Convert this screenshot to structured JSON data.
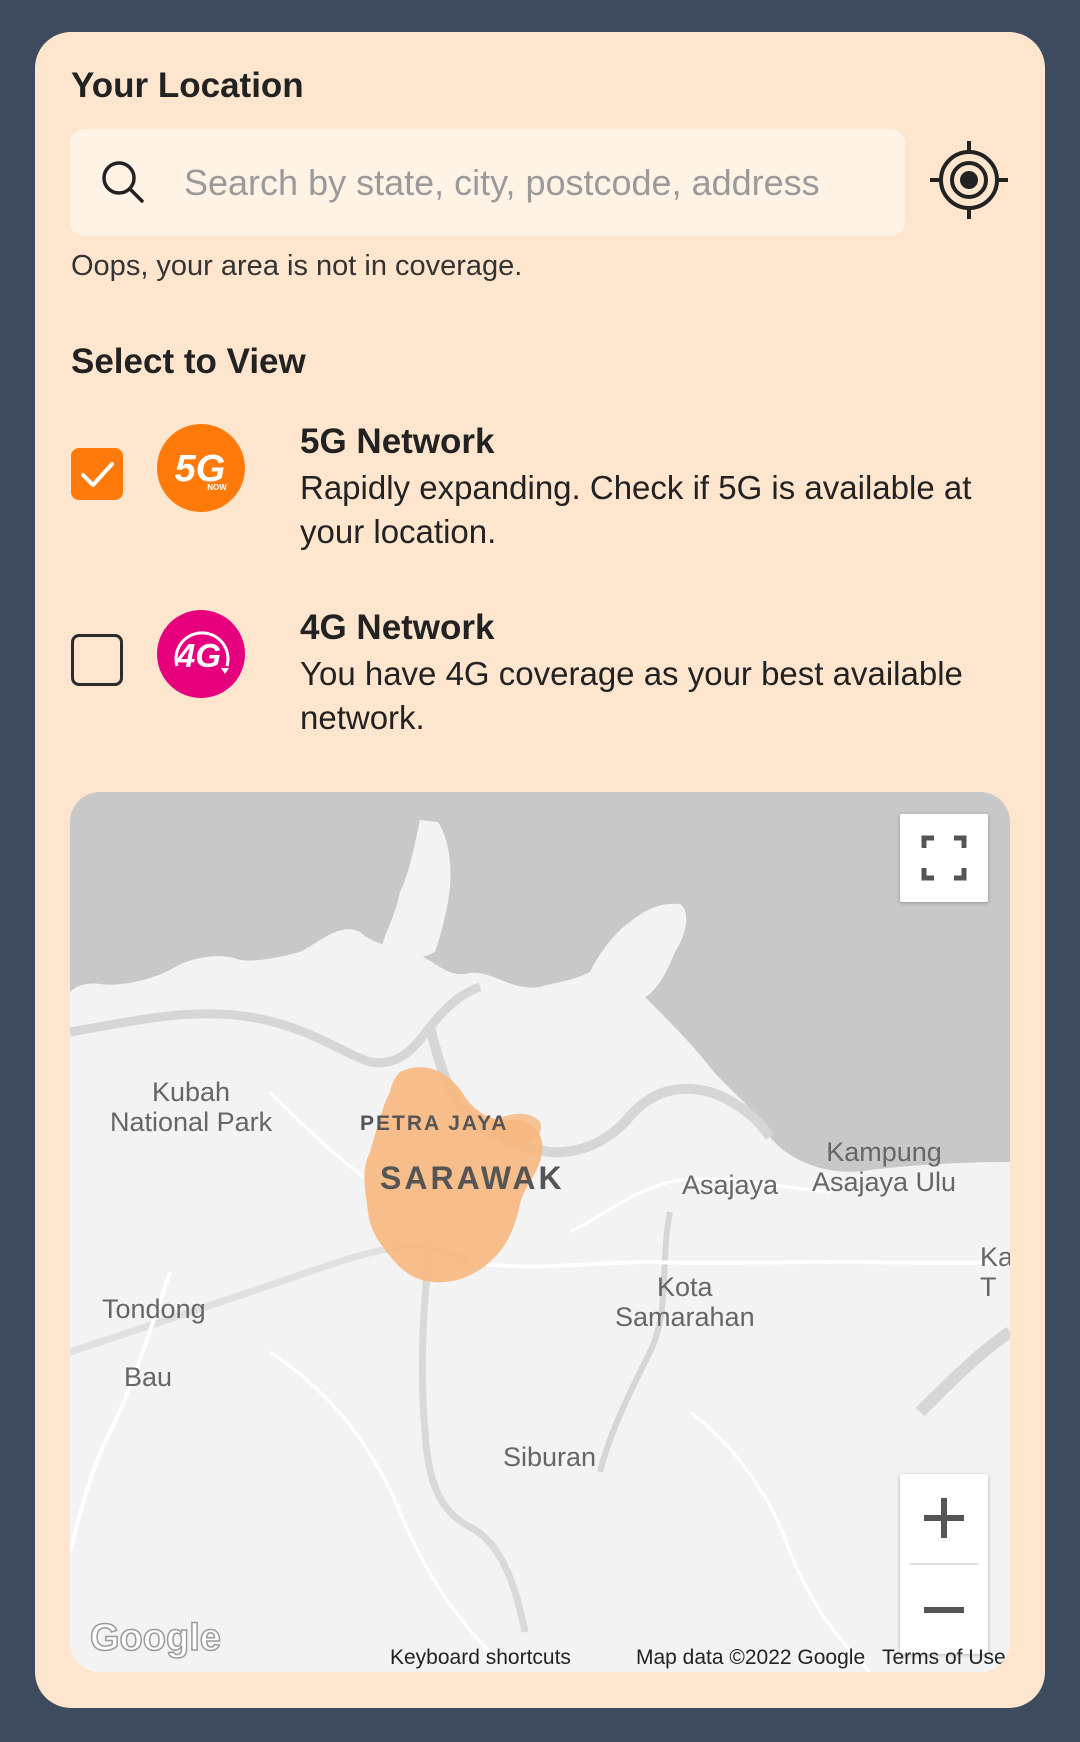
{
  "location": {
    "title": "Your Location",
    "search_placeholder": "Search by state, city, postcode, address",
    "search_value": "",
    "coverage_message": "Oops, your area is not in coverage."
  },
  "select": {
    "title": "Select to View",
    "networks": [
      {
        "name": "5G Network",
        "description": "Rapidly expanding. Check if 5G is available at your location.",
        "checked": true,
        "badge_text": "5G",
        "badge_subtext": "NOW",
        "badge_color": "#ff7a0a"
      },
      {
        "name": "4G Network",
        "description": "You have 4G coverage as your best available network.",
        "checked": false,
        "badge_text": "4G",
        "badge_color": "#e6007e"
      }
    ]
  },
  "map": {
    "labels": {
      "kubah": "Kubah\nNational Park",
      "petra_jaya": "PETRA JAYA",
      "sarawak": "SARAWAK",
      "asajaya": "Asajaya",
      "kampung": "Kampung\nAsajaya Ulu",
      "ka": "Ka\nT",
      "tondong": "Tondong",
      "bau": "Bau",
      "kota": "Kota\nSamarahan",
      "siburan": "Siburan"
    },
    "attribution": {
      "keyboard": "Keyboard shortcuts",
      "map_data": "Map data ©2022 Google",
      "terms": "Terms of Use"
    },
    "logo_text": "Google",
    "coverage_color": "#f7b77e"
  },
  "colors": {
    "page_bg": "#3e4b5e",
    "card_bg": "#fee5cd",
    "accent": "#ff7a0a"
  }
}
